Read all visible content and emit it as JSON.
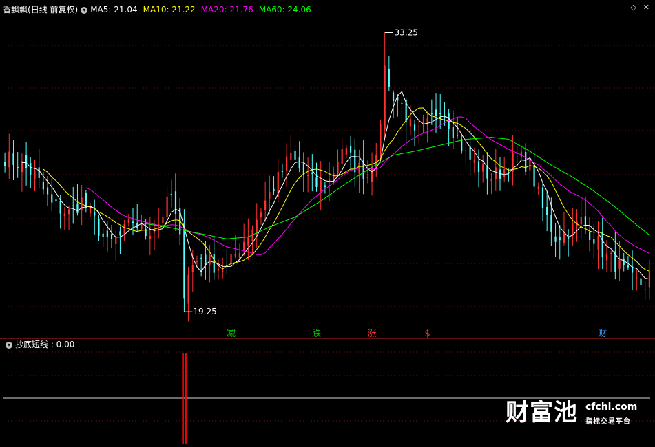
{
  "header": {
    "stock_name": "香飘飘",
    "period": "(日线 前复权)",
    "ma": [
      {
        "label": "MA5: 21.04",
        "color": "#ffffff"
      },
      {
        "label": "MA10: 21.22",
        "color": "#ffff00"
      },
      {
        "label": "MA20: 21.76",
        "color": "#ff00ff"
      },
      {
        "label": "MA60: 24.06",
        "color": "#00ff00"
      }
    ]
  },
  "sub_header": {
    "indicator": "抄底短线 : 0.00"
  },
  "icons": {
    "indicator_icon": "circle-arrow-icon",
    "window_controls": [
      "chevron-left-icon",
      "close-icon"
    ]
  },
  "colors": {
    "up": "#ff3333",
    "down": "#54ffff",
    "ma5": "#ffffff",
    "ma10": "#ffff00",
    "ma20": "#ff00ff",
    "ma60": "#00ff00",
    "grid": "#6e1212",
    "signal": "#ff0000"
  },
  "watermark": {
    "brand": "财富池",
    "url": "cfchi.com",
    "slogan": "指标交易平台"
  },
  "chart_data": {
    "type": "candlestick",
    "price_range": [
      18.6,
      34.2
    ],
    "high_label": "33.25",
    "low_label": "19.25",
    "high_value": 33.25,
    "low_value": 19.25,
    "high_index": 89,
    "low_index": 42,
    "close_path": [
      [
        0,
        27.0
      ],
      [
        4,
        26.6
      ],
      [
        7,
        26.1
      ],
      [
        11,
        24.6
      ],
      [
        15,
        24.2
      ],
      [
        18,
        24.8
      ],
      [
        21,
        23.8
      ],
      [
        24,
        22.6
      ],
      [
        27,
        23.0
      ],
      [
        30,
        23.8
      ],
      [
        33,
        23.2
      ],
      [
        36,
        23.7
      ],
      [
        39,
        25.1
      ],
      [
        41,
        22.8
      ],
      [
        43,
        21.3
      ],
      [
        46,
        22.0
      ],
      [
        49,
        21.6
      ],
      [
        52,
        21.4
      ],
      [
        55,
        22.5
      ],
      [
        58,
        23.5
      ],
      [
        61,
        24.8
      ],
      [
        64,
        25.9
      ],
      [
        67,
        27.1
      ],
      [
        70,
        26.1
      ],
      [
        73,
        25.6
      ],
      [
        76,
        25.8
      ],
      [
        79,
        27.5
      ],
      [
        82,
        26.6
      ],
      [
        85,
        26.1
      ],
      [
        88,
        28.2
      ],
      [
        90,
        30.4
      ],
      [
        93,
        29.6
      ],
      [
        96,
        28.0
      ],
      [
        99,
        28.6
      ],
      [
        102,
        29.6
      ],
      [
        105,
        28.4
      ],
      [
        108,
        27.1
      ],
      [
        111,
        26.5
      ],
      [
        114,
        26.0
      ],
      [
        117,
        26.4
      ],
      [
        120,
        27.1
      ],
      [
        123,
        26.5
      ],
      [
        126,
        24.4
      ],
      [
        129,
        23.0
      ],
      [
        132,
        23.3
      ],
      [
        135,
        23.8
      ],
      [
        138,
        23.0
      ],
      [
        141,
        22.0
      ],
      [
        144,
        21.5
      ],
      [
        147,
        20.8
      ],
      [
        150,
        20.6
      ],
      [
        151,
        21.1
      ]
    ],
    "ma60_path": [
      [
        32,
        23.7
      ],
      [
        38,
        23.5
      ],
      [
        45,
        23.2
      ],
      [
        52,
        22.9
      ],
      [
        57,
        23.0
      ],
      [
        62,
        23.5
      ],
      [
        68,
        24.0
      ],
      [
        74,
        24.8
      ],
      [
        80,
        25.7
      ],
      [
        86,
        26.5
      ],
      [
        91,
        27.1
      ],
      [
        96,
        27.3
      ],
      [
        102,
        27.6
      ],
      [
        108,
        27.9
      ],
      [
        114,
        28.0
      ],
      [
        118,
        27.9
      ],
      [
        123,
        27.3
      ],
      [
        128,
        26.6
      ],
      [
        133,
        26.0
      ],
      [
        138,
        25.3
      ],
      [
        143,
        24.5
      ],
      [
        148,
        23.6
      ],
      [
        151,
        23.1
      ]
    ],
    "signals": [
      {
        "index": 53,
        "label": "减",
        "color": "#00cc00"
      },
      {
        "index": 73,
        "label": "跌",
        "color": "#00cc00"
      },
      {
        "index": 86,
        "label": "涨",
        "color": "#ff3333"
      },
      {
        "index": 99,
        "label": "$",
        "color": "#ff3333"
      },
      {
        "index": 140,
        "label": "财",
        "color": "#3da5ff"
      }
    ],
    "sub_indicator": {
      "name": "抄底短线",
      "value": 0.0,
      "signal_index": 42
    }
  }
}
